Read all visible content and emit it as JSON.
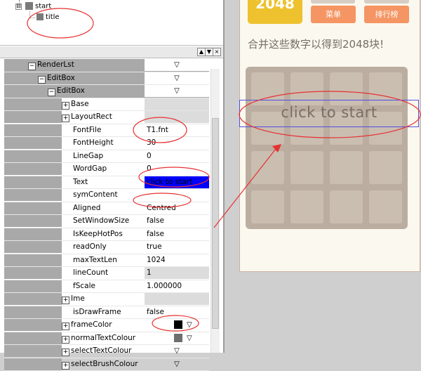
{
  "tree": {
    "root_label": "start",
    "child_label": "title",
    "collapse_glyph": "⊟"
  },
  "toolbar": {
    "btn_up": "▲",
    "btn_down": "▼",
    "btn_close": "×"
  },
  "properties": {
    "rows": [
      {
        "name": "RenderLst",
        "value": "▽",
        "indent": 1,
        "pm": "−",
        "header": true
      },
      {
        "name": "EditBox",
        "value": "▽",
        "indent": 2,
        "pm": "−",
        "header": true
      },
      {
        "name": "EditBox",
        "value": "▽",
        "indent": 3,
        "pm": "−",
        "header": true
      },
      {
        "name": "Base",
        "value": "",
        "indent": 4,
        "pm": "+",
        "style": "grey"
      },
      {
        "name": "LayoutRect",
        "value": "",
        "indent": 4,
        "pm": "+",
        "style": "grey"
      },
      {
        "name": "FontFile",
        "value": "T1.fnt",
        "indent": 4
      },
      {
        "name": "FontHeight",
        "value": "30",
        "indent": 4
      },
      {
        "name": "LineGap",
        "value": "0",
        "indent": 4
      },
      {
        "name": "WordGap",
        "value": "0",
        "indent": 4
      },
      {
        "name": "Text",
        "value": "click to start",
        "indent": 4,
        "style": "sel"
      },
      {
        "name": "symContent",
        "value": "",
        "indent": 4
      },
      {
        "name": "Aligned",
        "value": "Centred",
        "indent": 4
      },
      {
        "name": "SetWindowSize",
        "value": "false",
        "indent": 4
      },
      {
        "name": "IsKeepHotPos",
        "value": "false",
        "indent": 4
      },
      {
        "name": "readOnly",
        "value": "true",
        "indent": 4
      },
      {
        "name": "maxTextLen",
        "value": "1024",
        "indent": 4
      },
      {
        "name": "lineCount",
        "value": "1",
        "indent": 4,
        "style": "grey"
      },
      {
        "name": "fScale",
        "value": "1.000000",
        "indent": 4
      },
      {
        "name": "Ime",
        "value": "",
        "indent": 4,
        "pm": "+",
        "style": "grey"
      },
      {
        "name": "isDrawFrame",
        "value": "false",
        "indent": 4
      },
      {
        "name": "frameColor",
        "value": "▽",
        "indent": 4,
        "pm": "+",
        "swatch": "#000000"
      },
      {
        "name": "normalTextColour",
        "value": "▽",
        "indent": 4,
        "pm": "+",
        "swatch": "#6e6e6e"
      },
      {
        "name": "selectTextColour",
        "value": "▽",
        "indent": 4,
        "pm": "+"
      },
      {
        "name": "selectBrushColour",
        "value": "▽",
        "indent": 4,
        "pm": "+"
      }
    ]
  },
  "game": {
    "score_value": "2048",
    "menu_button": "菜单",
    "rank_button": "排行榜",
    "subtitle": "合并这些数字以得到2048块!",
    "start_text": "click to start"
  },
  "colors": {
    "annotation_red": "#e83030",
    "board": "#bbada0",
    "cell": "#cdc1b4",
    "orange_button": "#f59563",
    "score_tile": "#edc22e"
  }
}
